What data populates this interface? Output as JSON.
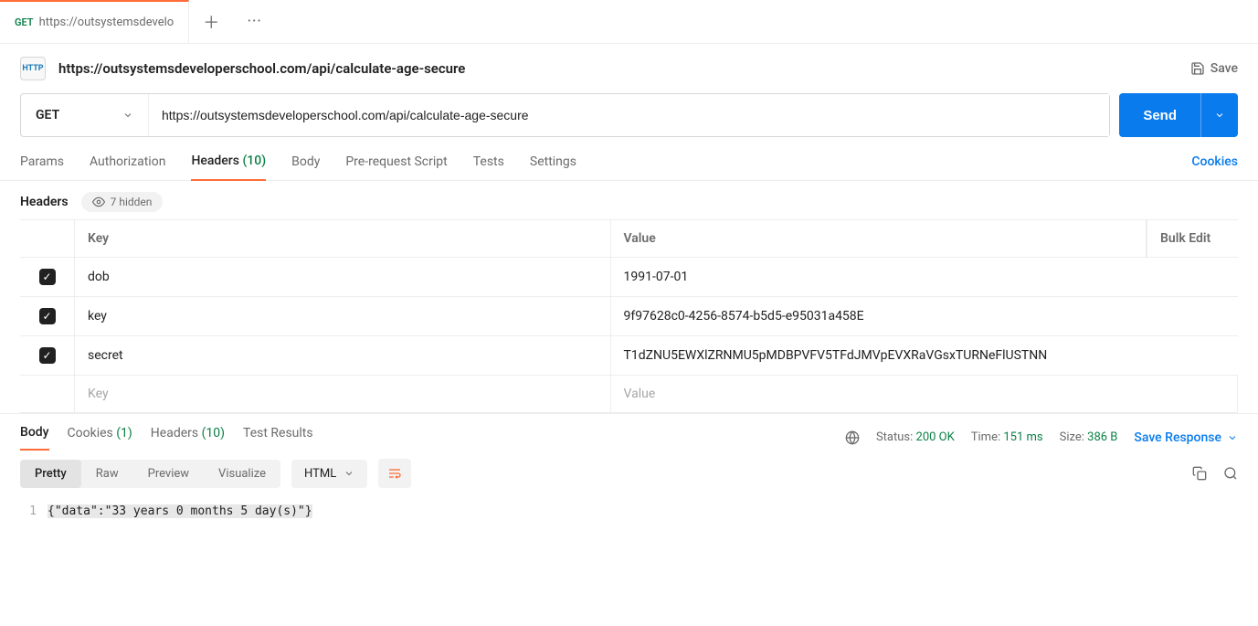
{
  "tab": {
    "method": "GET",
    "title": "https://outsystemsdevelo"
  },
  "titlebar": {
    "name": "https://outsystemsdeveloperschool.com/api/calculate-age-secure",
    "save": "Save"
  },
  "urlbar": {
    "method": "GET",
    "url": "https://outsystemsdeveloperschool.com/api/calculate-age-secure",
    "send": "Send"
  },
  "reqTabs": {
    "params": "Params",
    "authorization": "Authorization",
    "headers": "Headers",
    "headersCount": "(10)",
    "body": "Body",
    "prerequest": "Pre-request Script",
    "tests": "Tests",
    "settings": "Settings",
    "cookies": "Cookies"
  },
  "headersSection": {
    "label": "Headers",
    "hidden": "7 hidden"
  },
  "table": {
    "keyHeader": "Key",
    "valueHeader": "Value",
    "bulkEdit": "Bulk Edit",
    "keyPlaceholder": "Key",
    "valuePlaceholder": "Value",
    "rows": [
      {
        "key": "dob",
        "value": "1991-07-01"
      },
      {
        "key": "key",
        "value": "9f97628c0-4256-8574-b5d5-e95031a458E"
      },
      {
        "key": "secret",
        "value": "T1dZNU5EWXlZRNMU5pMDBPVFV5TFdJMVpEVXRaVGsxTURNeFlUSTNN"
      }
    ]
  },
  "response": {
    "tabs": {
      "body": "Body",
      "cookies": "Cookies",
      "cookiesCount": "(1)",
      "headers": "Headers",
      "headersCount": "(10)",
      "testResults": "Test Results"
    },
    "meta": {
      "statusLabel": "Status:",
      "statusValue": "200 OK",
      "timeLabel": "Time:",
      "timeValue": "151 ms",
      "sizeLabel": "Size:",
      "sizeValue": "386 B",
      "saveResponse": "Save Response"
    },
    "view": {
      "pretty": "Pretty",
      "raw": "Raw",
      "preview": "Preview",
      "visualize": "Visualize",
      "format": "HTML"
    },
    "code": {
      "lineNumber": "1",
      "content": "{\"data\":\"33 years 0 months 5 day(s)\"}"
    }
  }
}
